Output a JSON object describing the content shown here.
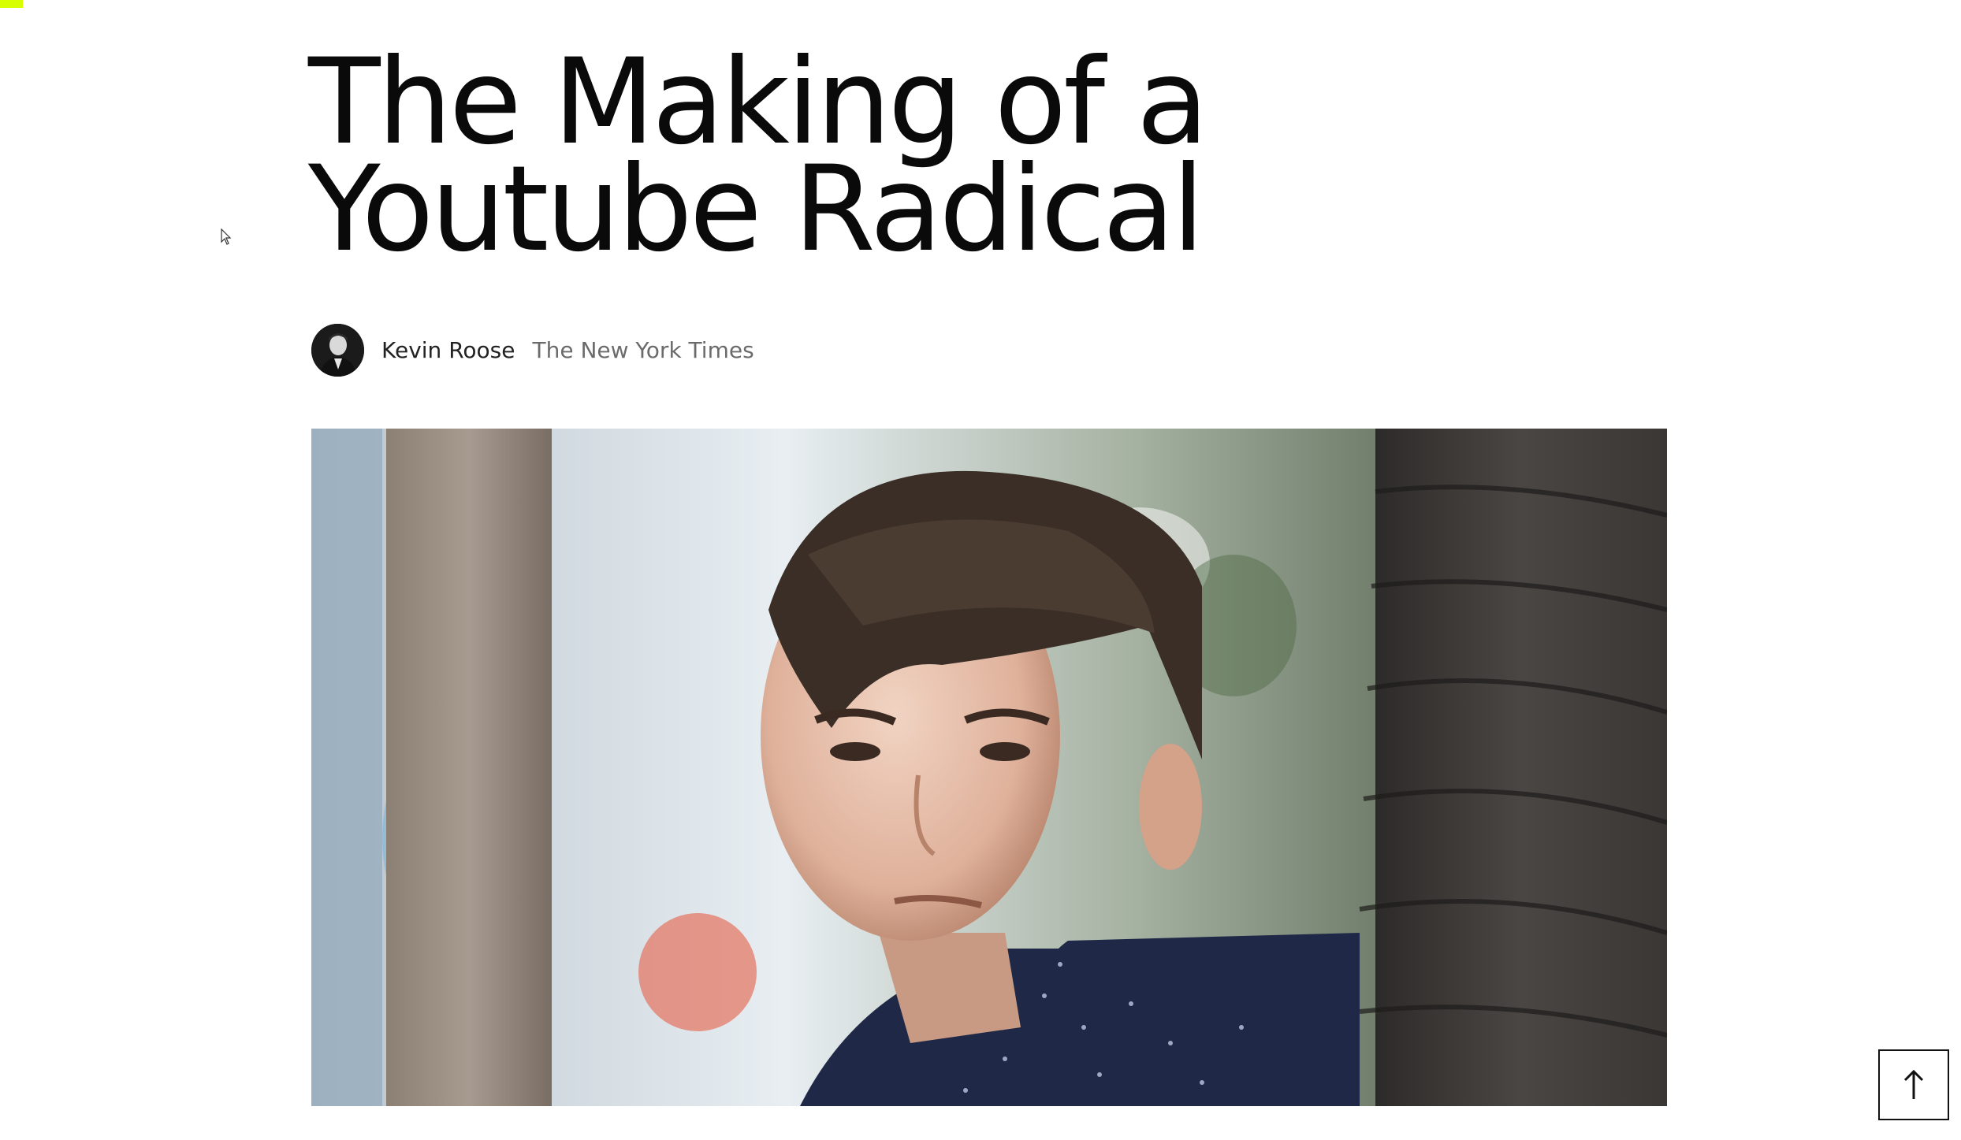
{
  "article": {
    "title": "The Making of a Youtube Radical",
    "author": "Kevin Roose",
    "publication": "The New York Times"
  },
  "icons": {
    "back_to_top": "arrow-up-icon",
    "cursor": "mouse-pointer-icon"
  },
  "colors": {
    "accent": "#d7ff00",
    "text": "#0a0a0a",
    "muted": "#6b6b6b"
  }
}
